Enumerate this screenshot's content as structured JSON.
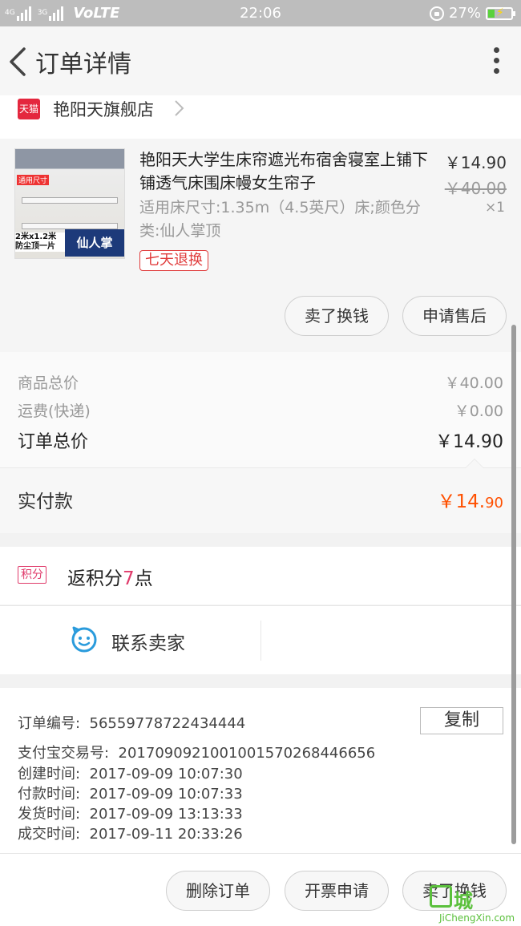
{
  "status_bar": {
    "signal": "4G",
    "signal2": "3G",
    "network": "VoLTE",
    "time": "22:06",
    "battery": "27%"
  },
  "header": {
    "title": "订单详情"
  },
  "shop": {
    "name": "艳阳天旗舰店",
    "badge": "天猫"
  },
  "product": {
    "title": "艳阳天大学生床帘遮光布宿舍寝室上铺下铺透气床围床幔女生帘子",
    "sku": "适用床尺寸:1.35m（4.5英尺）床;颜色分类:仙人掌顶",
    "price": "￥14.90",
    "original_price": "￥40.00",
    "quantity": "×1",
    "service_tag": "七天退换",
    "thumb_tag": "通用尺寸",
    "thumb_size": "2米x1.2米 防尘顶一片",
    "thumb_badge": "仙人掌",
    "buttons": {
      "sell": "卖了换钱",
      "after_sale": "申请售后"
    }
  },
  "totals": {
    "goods_label": "商品总价",
    "goods_value": "￥40.00",
    "shipping_label": "运费(快递)",
    "shipping_value": "￥0.00",
    "order_total_label": "订单总价",
    "order_total_value": "￥14.90",
    "paid_label": "实付款",
    "paid_int": "￥14.",
    "paid_dec": "90"
  },
  "points": {
    "tag": "积分",
    "prefix": "返积分",
    "number": "7",
    "suffix": "点"
  },
  "contact": {
    "label": "联系卖家"
  },
  "order_info": {
    "order_no_label": "订单编号:",
    "order_no": "56559778722434444",
    "copy": "复制",
    "alipay_label": "支付宝交易号:",
    "alipay_no": "2017090921001001570268446656",
    "created_label": "创建时间:",
    "created": "2017-09-09 10:07:30",
    "paid_label": "付款时间:",
    "paid": "2017-09-09 10:07:33",
    "shipped_label": "发货时间:",
    "shipped": "2017-09-09 13:13:33",
    "completed_label": "成交时间:",
    "completed": "2017-09-11 20:33:26"
  },
  "bottom_bar": {
    "delete": "删除订单",
    "invoice": "开票申请",
    "sell": "卖了换钱"
  },
  "watermark": {
    "text": "城",
    "url": "JiChengXin.com"
  },
  "colors": {
    "accent_orange": "#ff5000",
    "tmall_red": "#e4273e",
    "points_pink": "#e03b6b",
    "contact_blue": "#2a9bdc"
  }
}
